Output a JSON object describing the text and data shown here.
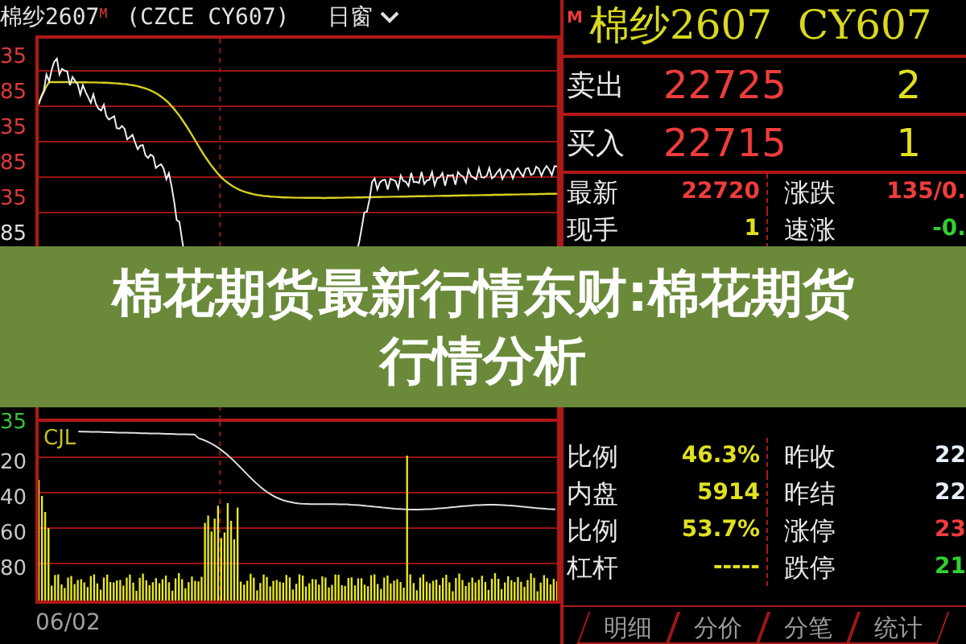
{
  "chart_header": {
    "symbol": "棉纱2607",
    "flag": "M",
    "exchange_code": "(CZCE CY607)",
    "period": "日窗"
  },
  "price_axis_upper": [
    {
      "text": "35",
      "color": "#e03a3a"
    },
    {
      "text": "85",
      "color": "#e03a3a"
    },
    {
      "text": "35",
      "color": "#e03a3a"
    },
    {
      "text": "85",
      "color": "#e03a3a"
    },
    {
      "text": "35",
      "color": "#e03a3a"
    },
    {
      "text": "85",
      "color": "#dddddd"
    }
  ],
  "price_axis_lower": [
    {
      "text": "35",
      "color": "#3ac03a"
    }
  ],
  "volume_panel": {
    "label": "CJL",
    "axis": [
      "20",
      "40",
      "60",
      "80"
    ]
  },
  "date": "06/02",
  "quote_header": {
    "flag": "M",
    "title": "棉纱2607  CY607"
  },
  "order_book": [
    {
      "label": "卖出",
      "price": "22725",
      "volume": "2"
    },
    {
      "label": "买入",
      "price": "22715",
      "volume": "1"
    }
  ],
  "stats_upper": [
    {
      "left": {
        "label": "最新",
        "value": "22720",
        "color": "#f03c3c"
      },
      "right": {
        "label": "涨跌",
        "value": "135/0.",
        "color": "#f03c3c"
      }
    },
    {
      "left": {
        "label": "现手",
        "value": "1",
        "color": "#e0e020"
      },
      "right": {
        "label": "速涨",
        "value": "-0.",
        "color": "#30d030"
      }
    }
  ],
  "stats_lower": [
    {
      "left": {
        "label": "比例",
        "value": "46.3%",
        "color": "#e0e020"
      },
      "right": {
        "label": "昨收",
        "value": "22",
        "color": "#e8f0ff"
      }
    },
    {
      "left": {
        "label": "内盘",
        "value": "5914",
        "color": "#e0e020"
      },
      "right": {
        "label": "昨结",
        "value": "22",
        "color": "#e8f0ff"
      }
    },
    {
      "left": {
        "label": "比例",
        "value": "53.7%",
        "color": "#e0e020"
      },
      "right": {
        "label": "涨停",
        "value": "23",
        "color": "#f03c3c"
      }
    },
    {
      "left": {
        "label": "杠杆",
        "value": "-----",
        "color": "#e0e020"
      },
      "right": {
        "label": "跌停",
        "value": "21",
        "color": "#30d030"
      }
    }
  ],
  "tabs": [
    {
      "label": "明细",
      "selected": false
    },
    {
      "label": "分价",
      "selected": false
    },
    {
      "label": "分笔",
      "selected": false
    },
    {
      "label": "统计",
      "selected": false
    }
  ],
  "banner": {
    "lines": [
      "棉花期货最新行情东财:棉花期货",
      "行情分析"
    ]
  }
}
